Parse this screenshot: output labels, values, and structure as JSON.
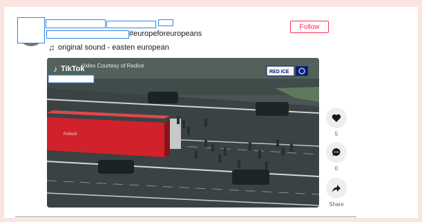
{
  "post": {
    "hashtag": "#europeforeuropeans",
    "sound": "original sound - easten european",
    "follow_label": "Follow"
  },
  "video": {
    "watermark": "TikTok",
    "credit": "Video Courtesy of Redice",
    "badge": "RED ICE",
    "truck_text": "Pollock"
  },
  "actions": {
    "like_count": "5",
    "comment_count": "0",
    "share_label": "Share"
  },
  "colors": {
    "accent": "#fe2c55",
    "background": "#fbe5e1",
    "redaction_border": "#2f86e8"
  }
}
